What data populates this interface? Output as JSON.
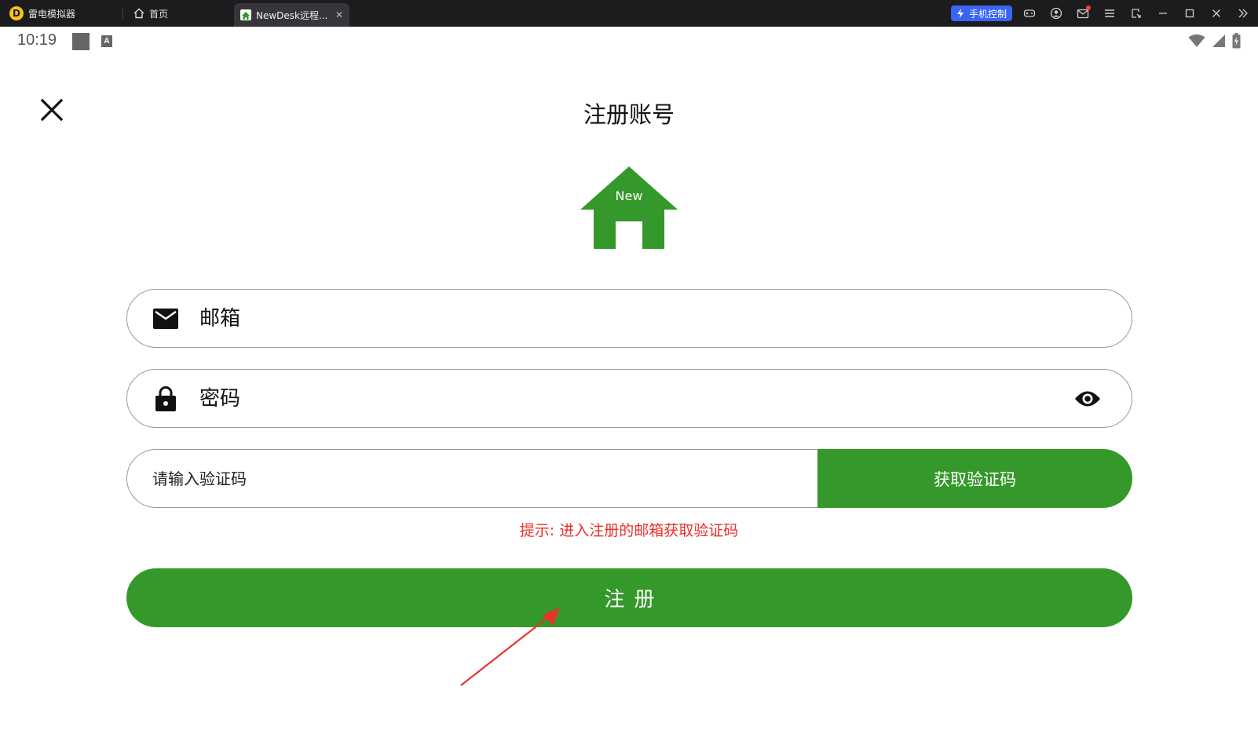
{
  "emulator": {
    "app_name": "雷电模拟器",
    "tabs": [
      {
        "label": "首页"
      },
      {
        "label": "NewDesk远程..."
      }
    ],
    "phone_control_label": "手机控制"
  },
  "status_bar": {
    "time": "10:19",
    "input_indicator": "A"
  },
  "page": {
    "title": "注册账号",
    "logo_text": "New",
    "email_placeholder": "邮箱",
    "password_placeholder": "密码",
    "code_placeholder": "请输入验证码",
    "get_code_label": "获取验证码",
    "hint": "提示: 进入注册的邮箱获取验证码",
    "register_label": "注册"
  },
  "colors": {
    "brand_green": "#35982a",
    "hint_red": "#e8322c",
    "annotation_arrow": "#e8322c",
    "phone_control_blue": "#3a64f2"
  }
}
